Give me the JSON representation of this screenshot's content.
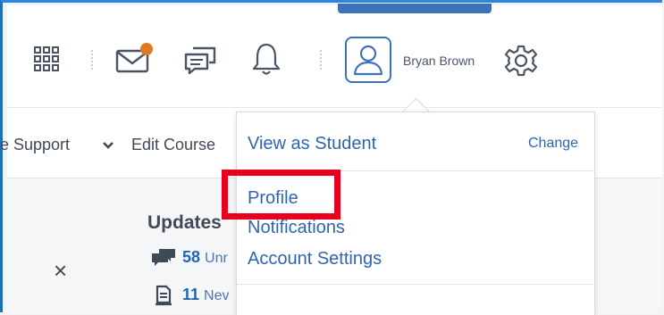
{
  "header": {
    "username": "Bryan Brown",
    "icons": [
      "grid-icon",
      "mail-icon",
      "chat-icon",
      "bell-icon",
      "avatar-icon",
      "gear-icon"
    ],
    "colors": {
      "accent": "#3b73b9",
      "notification_dot": "#e07a1f"
    }
  },
  "navbar": {
    "items": [
      {
        "label": "e Support",
        "has_dropdown": true
      },
      {
        "label": "Edit Course"
      }
    ]
  },
  "content": {
    "updates_title": "Updates",
    "stats": [
      {
        "count": "58",
        "label": "Unr",
        "icon": "chat-bubbles-icon"
      },
      {
        "count": "11",
        "label": "Nev",
        "icon": "document-icon"
      }
    ],
    "close_symbol": "×"
  },
  "dropdown": {
    "view_as_label": "View as Student",
    "change_label": "Change",
    "items": [
      "Profile",
      "Notifications",
      "Account Settings"
    ]
  },
  "annotation": {
    "highlight_color": "#e8001c"
  }
}
